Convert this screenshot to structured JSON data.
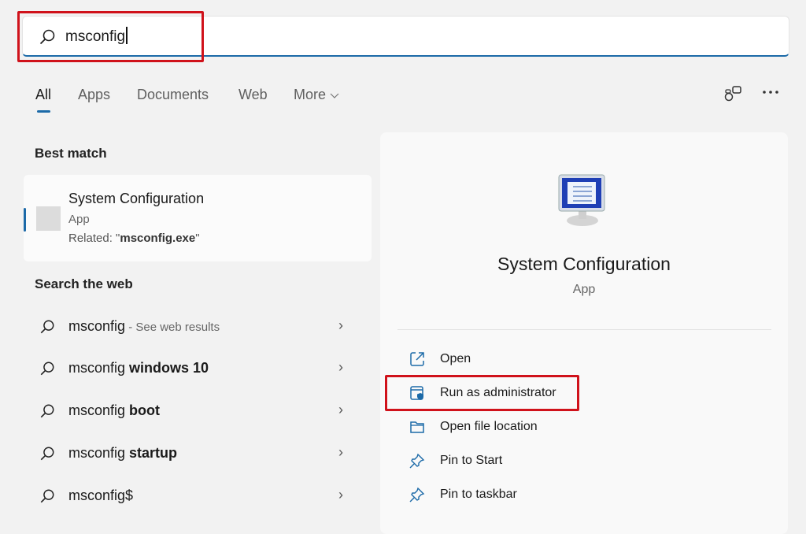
{
  "search": {
    "query": "msconfig"
  },
  "tabs": [
    {
      "label": "All"
    },
    {
      "label": "Apps"
    },
    {
      "label": "Documents"
    },
    {
      "label": "Web"
    },
    {
      "label": "More"
    }
  ],
  "best_match": {
    "heading": "Best match",
    "title": "System Configuration",
    "type": "App",
    "related_prefix": "Related: \"",
    "related_file": "msconfig.exe",
    "related_suffix": "\""
  },
  "web": {
    "heading": "Search the web",
    "results": [
      {
        "query": "msconfig",
        "suffix": "",
        "note": " - See web results"
      },
      {
        "query": "msconfig ",
        "suffix": "windows 10",
        "note": ""
      },
      {
        "query": "msconfig ",
        "suffix": "boot",
        "note": ""
      },
      {
        "query": "msconfig ",
        "suffix": "startup",
        "note": ""
      },
      {
        "query": "msconfig",
        "suffix": "$",
        "note": ""
      }
    ]
  },
  "detail": {
    "title": "System Configuration",
    "type": "App",
    "actions": [
      {
        "label": "Open"
      },
      {
        "label": "Run as administrator"
      },
      {
        "label": "Open file location"
      },
      {
        "label": "Pin to Start"
      },
      {
        "label": "Pin to taskbar"
      }
    ]
  },
  "colors": {
    "accent": "#1c6aa8",
    "highlight": "#d0121b"
  }
}
